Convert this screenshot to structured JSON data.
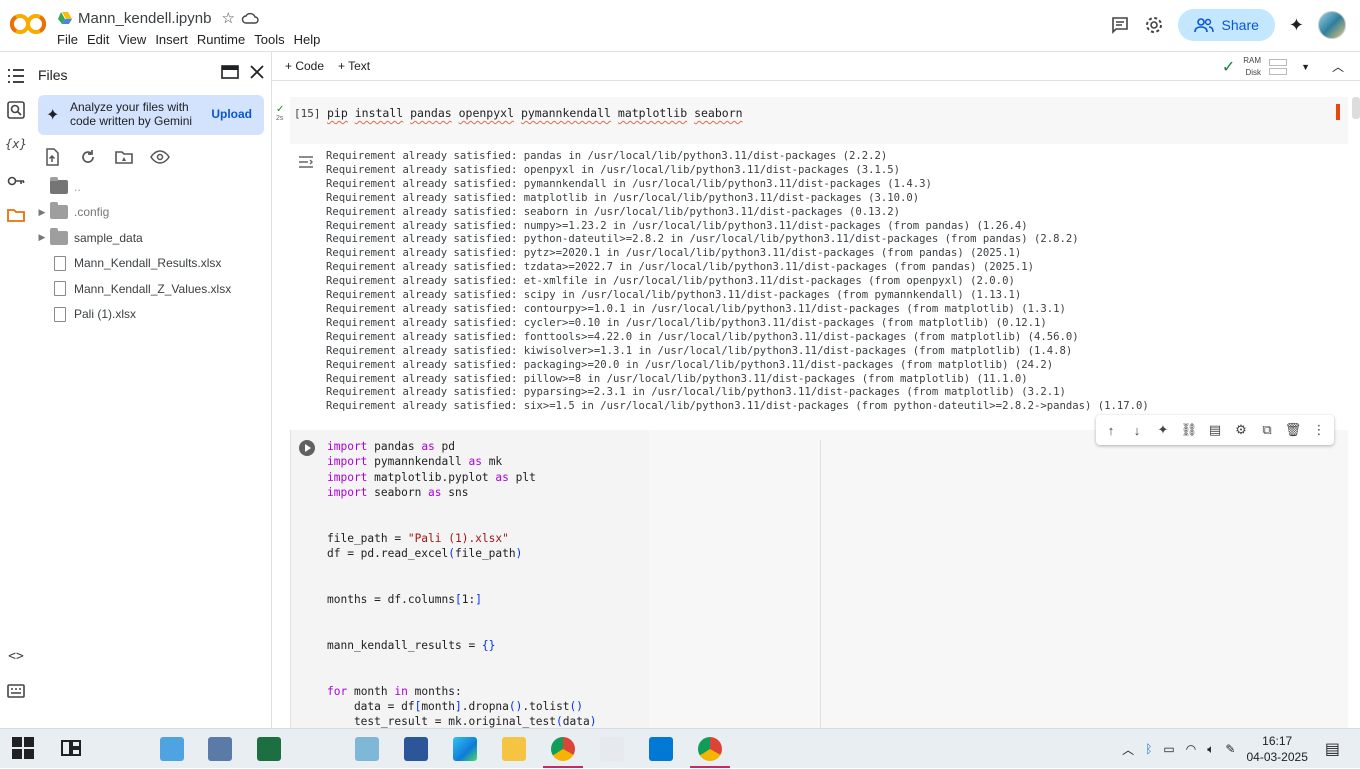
{
  "app": {
    "logo_text": "CO",
    "notebook_title": "Mann_kendell.ipynb",
    "menu": [
      "File",
      "Edit",
      "View",
      "Insert",
      "Runtime",
      "Tools",
      "Help"
    ],
    "share_label": "Share"
  },
  "rail_icons": [
    "toc-icon",
    "search-icon",
    "variables-icon",
    "key-icon",
    "folder-icon",
    "code-snippets-icon",
    "terminal-icon"
  ],
  "files_panel": {
    "title": "Files",
    "gemini_text": "Analyze your files with code written by Gemini",
    "upload_label": "Upload",
    "items": [
      {
        "name": "..",
        "type": "folder-up",
        "expandable": false
      },
      {
        "name": ".config",
        "type": "folder",
        "expandable": true
      },
      {
        "name": "sample_data",
        "type": "folder",
        "expandable": true
      },
      {
        "name": "Mann_Kendall_Results.xlsx",
        "type": "file",
        "expandable": false
      },
      {
        "name": "Mann_Kendall_Z_Values.xlsx",
        "type": "file",
        "expandable": false
      },
      {
        "name": "Pali (1).xlsx",
        "type": "file",
        "expandable": false
      }
    ]
  },
  "notebook_toolbar": {
    "add_code": "+ Code",
    "add_text": "+ Text",
    "ram_label": "RAM",
    "disk_label": "Disk"
  },
  "cell1": {
    "exec_count": "[15]",
    "time": "2s",
    "code_words": [
      "pip",
      "install",
      "pandas",
      "openpyxl",
      "pymannkendall",
      "matplotlib",
      "seaborn"
    ],
    "output": [
      "Requirement already satisfied: pandas in /usr/local/lib/python3.11/dist-packages (2.2.2)",
      "Requirement already satisfied: openpyxl in /usr/local/lib/python3.11/dist-packages (3.1.5)",
      "Requirement already satisfied: pymannkendall in /usr/local/lib/python3.11/dist-packages (1.4.3)",
      "Requirement already satisfied: matplotlib in /usr/local/lib/python3.11/dist-packages (3.10.0)",
      "Requirement already satisfied: seaborn in /usr/local/lib/python3.11/dist-packages (0.13.2)",
      "Requirement already satisfied: numpy>=1.23.2 in /usr/local/lib/python3.11/dist-packages (from pandas) (1.26.4)",
      "Requirement already satisfied: python-dateutil>=2.8.2 in /usr/local/lib/python3.11/dist-packages (from pandas) (2.8.2)",
      "Requirement already satisfied: pytz>=2020.1 in /usr/local/lib/python3.11/dist-packages (from pandas) (2025.1)",
      "Requirement already satisfied: tzdata>=2022.7 in /usr/local/lib/python3.11/dist-packages (from pandas) (2025.1)",
      "Requirement already satisfied: et-xmlfile in /usr/local/lib/python3.11/dist-packages (from openpyxl) (2.0.0)",
      "Requirement already satisfied: scipy in /usr/local/lib/python3.11/dist-packages (from pymannkendall) (1.13.1)",
      "Requirement already satisfied: contourpy>=1.0.1 in /usr/local/lib/python3.11/dist-packages (from matplotlib) (1.3.1)",
      "Requirement already satisfied: cycler>=0.10 in /usr/local/lib/python3.11/dist-packages (from matplotlib) (0.12.1)",
      "Requirement already satisfied: fonttools>=4.22.0 in /usr/local/lib/python3.11/dist-packages (from matplotlib) (4.56.0)",
      "Requirement already satisfied: kiwisolver>=1.3.1 in /usr/local/lib/python3.11/dist-packages (from matplotlib) (1.4.8)",
      "Requirement already satisfied: packaging>=20.0 in /usr/local/lib/python3.11/dist-packages (from matplotlib) (24.2)",
      "Requirement already satisfied: pillow>=8 in /usr/local/lib/python3.11/dist-packages (from matplotlib) (11.1.0)",
      "Requirement already satisfied: pyparsing>=2.3.1 in /usr/local/lib/python3.11/dist-packages (from matplotlib) (3.2.1)",
      "Requirement already satisfied: six>=1.5 in /usr/local/lib/python3.11/dist-packages (from python-dateutil>=2.8.2->pandas) (1.17.0)"
    ]
  },
  "cell2": {
    "code_lines": [
      [
        {
          "t": "import",
          "c": "kw"
        },
        {
          "t": " pandas "
        },
        {
          "t": "as",
          "c": "kw"
        },
        {
          "t": " pd"
        }
      ],
      [
        {
          "t": "import",
          "c": "kw"
        },
        {
          "t": " pymannkendall "
        },
        {
          "t": "as",
          "c": "kw"
        },
        {
          "t": " mk"
        }
      ],
      [
        {
          "t": "import",
          "c": "kw"
        },
        {
          "t": " matplotlib.pyplot "
        },
        {
          "t": "as",
          "c": "kw"
        },
        {
          "t": " plt"
        }
      ],
      [
        {
          "t": "import",
          "c": "kw"
        },
        {
          "t": " seaborn "
        },
        {
          "t": "as",
          "c": "kw"
        },
        {
          "t": " sns"
        }
      ],
      [],
      [],
      [
        {
          "t": "file_path = "
        },
        {
          "t": "\"Pali (1).xlsx\"",
          "c": "str"
        }
      ],
      [
        {
          "t": "df = pd.read_excel"
        },
        {
          "t": "(",
          "c": "br"
        },
        {
          "t": "file_path"
        },
        {
          "t": ")",
          "c": "br"
        }
      ],
      [],
      [],
      [
        {
          "t": "months = df.columns"
        },
        {
          "t": "[",
          "c": "br"
        },
        {
          "t": "1:"
        },
        {
          "t": "]",
          "c": "br"
        }
      ],
      [],
      [],
      [
        {
          "t": "mann_kendall_results = "
        },
        {
          "t": "{}",
          "c": "br"
        }
      ],
      [],
      [],
      [
        {
          "t": "for",
          "c": "kw"
        },
        {
          "t": " month "
        },
        {
          "t": "in",
          "c": "kw"
        },
        {
          "t": " months:"
        }
      ],
      [
        {
          "t": "    data = df"
        },
        {
          "t": "[",
          "c": "br"
        },
        {
          "t": "month"
        },
        {
          "t": "]",
          "c": "br"
        },
        {
          "t": ".dropna"
        },
        {
          "t": "()",
          "c": "br"
        },
        {
          "t": ".tolist"
        },
        {
          "t": "()",
          "c": "br"
        }
      ],
      [
        {
          "t": "    test_result = mk.original_test"
        },
        {
          "t": "(",
          "c": "br"
        },
        {
          "t": "data"
        },
        {
          "t": ")",
          "c": "br"
        }
      ]
    ]
  },
  "cell_toolbar_icons": [
    "move-up-icon",
    "move-down-icon",
    "gemini-icon",
    "link-icon",
    "comment-icon",
    "settings-icon",
    "mirror-cell-icon",
    "delete-icon",
    "more-icon"
  ],
  "taskbar": {
    "apps": [
      "windows-start-icon",
      "task-view-icon",
      "control-panel-icon",
      "network-app-icon",
      "excel-icon",
      "notepad-icon",
      "word-icon",
      "edge-icon",
      "file-explorer-icon",
      "chrome-icon",
      "snipping-tool-icon",
      "vscode-icon",
      "chrome-profile-icon"
    ],
    "time": "16:17",
    "date": "04-03-2025"
  },
  "colors": {
    "share_bg": "#c2e7ff",
    "gemini_bg": "#d3e3fd",
    "keyword": "#af00db",
    "string": "#a31515",
    "bracket": "#0431fa",
    "running_marker": "#e8470d",
    "success_check": "#188038"
  }
}
